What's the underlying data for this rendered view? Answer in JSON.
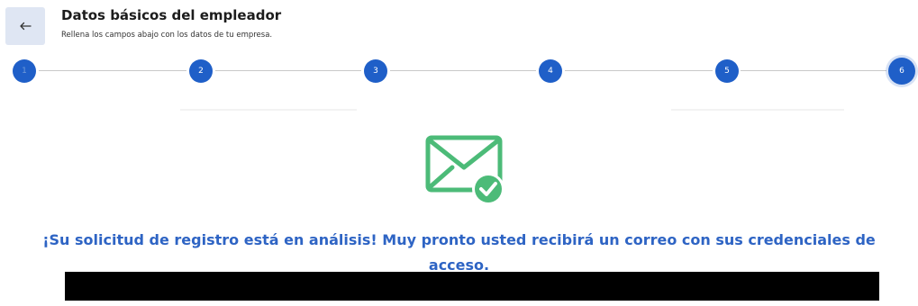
{
  "header": {
    "title": "Datos básicos del empleador",
    "subtitle": "Rellena los campos abajo con los datos de tu empresa."
  },
  "stepper": {
    "steps": [
      {
        "label": "1",
        "state": "done"
      },
      {
        "label": "2",
        "state": "done"
      },
      {
        "label": "3",
        "state": "done"
      },
      {
        "label": "4",
        "state": "done"
      },
      {
        "label": "5",
        "state": "done"
      },
      {
        "label": "6",
        "state": "current"
      }
    ]
  },
  "confirmation": {
    "icon": "mail-check-icon",
    "message": "¡Su solicitud de registro está en análisis! Muy pronto usted recibirá un correo con sus credenciales de acceso."
  },
  "colors": {
    "primary": "#1f5fc8",
    "message_text": "#2e64c4",
    "success_icon": "#4cbb78",
    "back_button_bg": "#dfe6f3"
  }
}
